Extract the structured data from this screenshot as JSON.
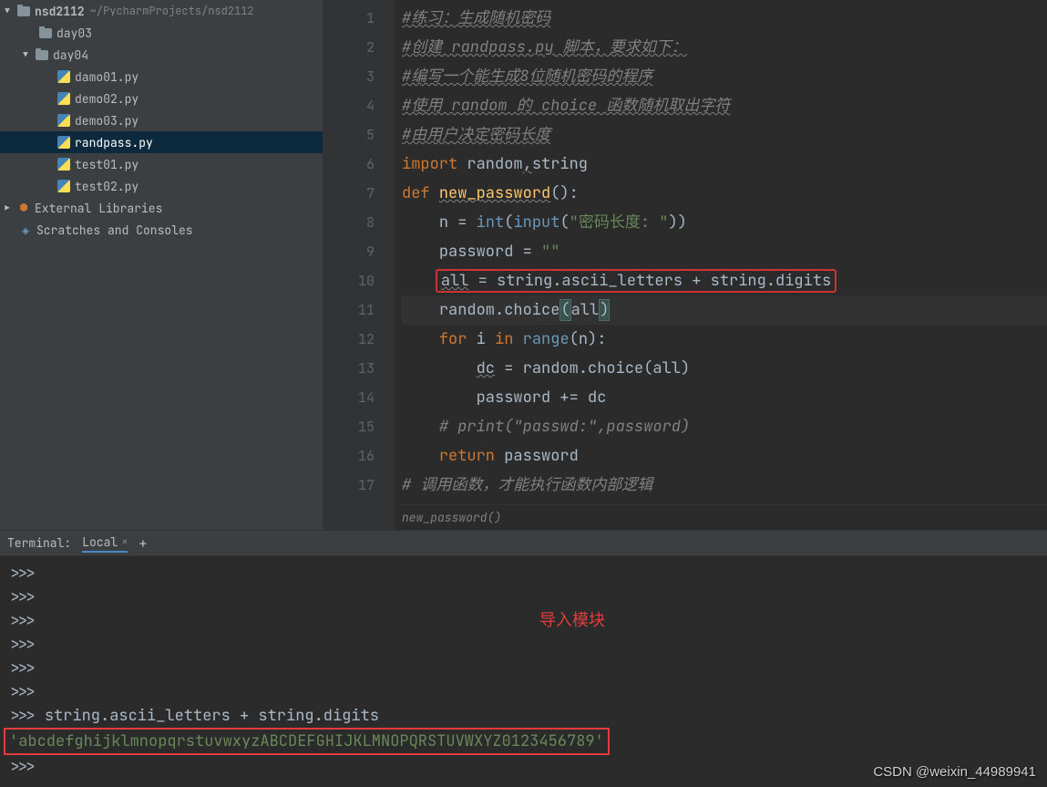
{
  "project": {
    "name": "nsd2112",
    "path": "~/PycharmProjects/nsd2112"
  },
  "tree": {
    "day03": "day03",
    "day04": "day04",
    "files": [
      "damo01.py",
      "demo02.py",
      "demo03.py",
      "randpass.py",
      "test01.py",
      "test02.py"
    ],
    "external": "External Libraries",
    "scratches": "Scratches and Consoles"
  },
  "code": {
    "lines": [
      "1",
      "2",
      "3",
      "4",
      "5",
      "6",
      "7",
      "8",
      "9",
      "10",
      "11",
      "12",
      "13",
      "14",
      "15",
      "16",
      "17"
    ],
    "c1": "#练习：生成随机密码",
    "c2": "#创建 randpass.py 脚本，要求如下：",
    "c3": "#编写一个能生成8位随机密码的程序",
    "c4": "#使用 random 的 choice 函数随机取出字符",
    "c5": "#由用户决定密码长度",
    "l6_import": "import",
    "l6_r": " random",
    "l6_s": "string",
    "l7_def": "def",
    "l7_fn": "new_password",
    "l8_n": "n = ",
    "l8_int": "int",
    "l8_input": "input",
    "l8_str": "\"密码长度: \"",
    "l9": "password = ",
    "l9_str": "\"\"",
    "l10_all": "all",
    "l10_rest": " = string.ascii_letters + string.digits",
    "l11": "random.choice",
    "l11_all": "all",
    "l12_for": "for",
    "l12_i": " i ",
    "l12_in": "in",
    "l12_range": "range",
    "l12_rest": "(n):",
    "l13_dc": "dc",
    "l13_rest": " = random.choice(all)",
    "l14": "password += dc",
    "l15": "# print(\"passwd:\",password)",
    "l16_ret": "return",
    "l16_pw": " password",
    "l17": "# 调用函数，才能执行函数内部逻辑"
  },
  "crumb": "new_password()",
  "terminal": {
    "label": "Terminal:",
    "tab": "Local",
    "annotation": "导入模块",
    "prompt": ">>>",
    "cmd": "string.ascii_letters + string.digits",
    "result": "'abcdefghijklmnopqrstuvwxyzABCDEFGHIJKLMNOPQRSTUVWXYZ0123456789'"
  },
  "watermark": "CSDN @weixin_44989941"
}
